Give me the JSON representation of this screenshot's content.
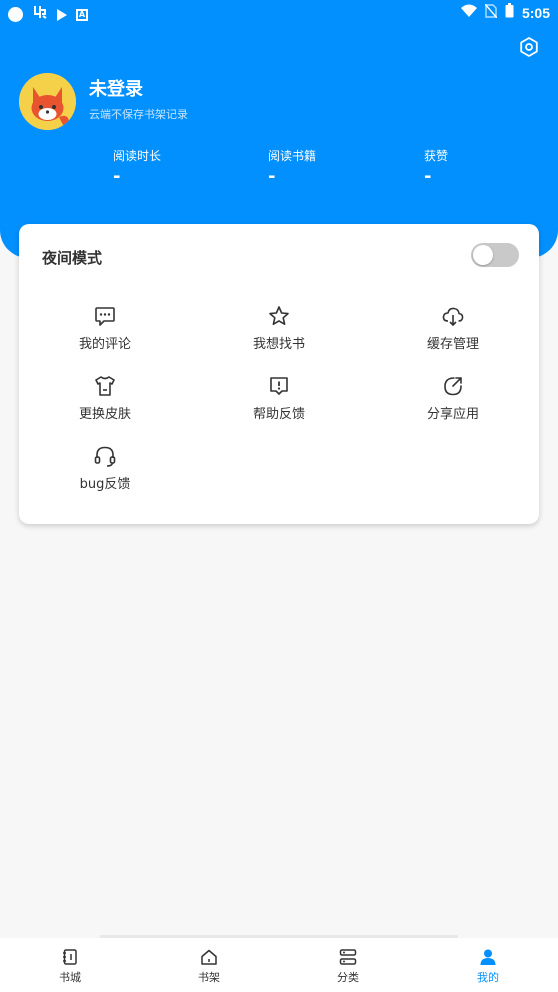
{
  "status_bar": {
    "left_icons": [
      "circle-icon",
      "app-icon",
      "play-icon",
      "a-icon"
    ],
    "time": "5:05"
  },
  "profile": {
    "name": "未登录",
    "subtitle": "云端不保存书架记录"
  },
  "stats": [
    {
      "label": "阅读时长",
      "value": "-"
    },
    {
      "label": "阅读书籍",
      "value": "-"
    },
    {
      "label": "获赞",
      "value": "-"
    }
  ],
  "card": {
    "night_mode": {
      "label": "夜间模式",
      "enabled": false
    },
    "items": [
      {
        "label": "我的评论",
        "icon": "comment-icon"
      },
      {
        "label": "我想找书",
        "icon": "star-icon"
      },
      {
        "label": "缓存管理",
        "icon": "cloud-download-icon"
      },
      {
        "label": "更换皮肤",
        "icon": "shirt-icon"
      },
      {
        "label": "帮助反馈",
        "icon": "help-feedback-icon"
      },
      {
        "label": "分享应用",
        "icon": "share-icon"
      },
      {
        "label": "bug反馈",
        "icon": "headset-icon"
      }
    ]
  },
  "bottom_nav": [
    {
      "label": "书城",
      "icon": "book-icon",
      "active": false
    },
    {
      "label": "书架",
      "icon": "home-icon",
      "active": false
    },
    {
      "label": "分类",
      "icon": "category-icon",
      "active": false
    },
    {
      "label": "我的",
      "icon": "user-icon",
      "active": true
    }
  ],
  "colors": {
    "primary": "#0290ff",
    "background": "#f7f7f7",
    "card": "#ffffff",
    "toggle_off": "#c9c9c9"
  }
}
